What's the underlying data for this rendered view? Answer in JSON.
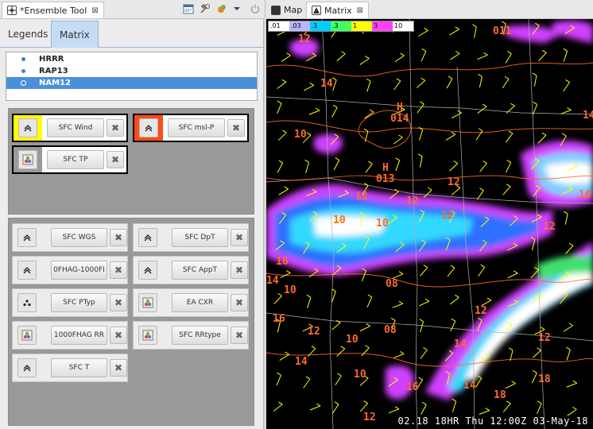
{
  "left": {
    "tab_title": "*Ensemble Tool",
    "tab_close": "⊠",
    "subtabs": [
      "Legends",
      "Matrix"
    ],
    "models": [
      {
        "name": "HRRR",
        "selected": false
      },
      {
        "name": "RAP13",
        "selected": false
      },
      {
        "name": "NAM12",
        "selected": true
      }
    ],
    "group1": [
      {
        "label": "SFC Wind",
        "color": "#ffff00",
        "icon": "chevron-up-icon"
      },
      {
        "label": "SFC msl-P",
        "color": "#ff4a1a",
        "icon": "chevron-up-icon"
      },
      {
        "label": "SFC TP",
        "color": "#9a9a9a",
        "icon": "image-icon"
      }
    ],
    "group2": [
      {
        "label": "SFC WGS",
        "icon": "chevron-up-icon"
      },
      {
        "label": "SFC DpT",
        "icon": "chevron-up-icon"
      },
      {
        "label": "0FHAG-1000FI",
        "icon": "chevron-up-icon"
      },
      {
        "label": "SFC AppT",
        "icon": "chevron-up-icon"
      },
      {
        "label": "SFC PTyp",
        "icon": "dots-icon"
      },
      {
        "label": "EA CXR",
        "icon": "image-icon"
      },
      {
        "label": "1000FHAG RR",
        "icon": "image-icon"
      },
      {
        "label": "SFC RRtype",
        "icon": "image-icon"
      },
      {
        "label": "SFC T",
        "icon": "chevron-up-icon"
      }
    ],
    "remove_glyph": "✖"
  },
  "right": {
    "tabs": [
      {
        "label": "Map",
        "active": false
      },
      {
        "label": "Matrix",
        "active": true,
        "close": "⊠"
      }
    ],
    "colorbar": [
      {
        "label": ".01",
        "color": "#ffffff"
      },
      {
        "label": ".03",
        "color": "#b8b8ff"
      },
      {
        "label": ".1",
        "color": "#00ccff"
      },
      {
        "label": ".3",
        "color": "#40ff60"
      },
      {
        "label": "1",
        "color": "#ffff00"
      },
      {
        "label": "3",
        "color": "#ff40ff"
      },
      {
        "label": "10",
        "color": "#ffffff"
      }
    ],
    "overlay_numbers": [
      "12",
      "011",
      "14",
      "10",
      "H",
      "014",
      "H",
      "013",
      "12",
      "12",
      "10",
      "12",
      "10",
      "12",
      "14",
      "16",
      "08",
      "16",
      "12",
      "14",
      "10",
      "08",
      "12",
      "10",
      "12",
      "14",
      "18",
      "18",
      "14",
      "16",
      "12",
      "10",
      "14",
      "16",
      "12"
    ],
    "status": "02.18   18HR Thu 12:00Z 03-May-18"
  },
  "colors": {
    "selection": "#4a90d9",
    "contour": "#ff6a2a",
    "barb": "#ffff00"
  }
}
